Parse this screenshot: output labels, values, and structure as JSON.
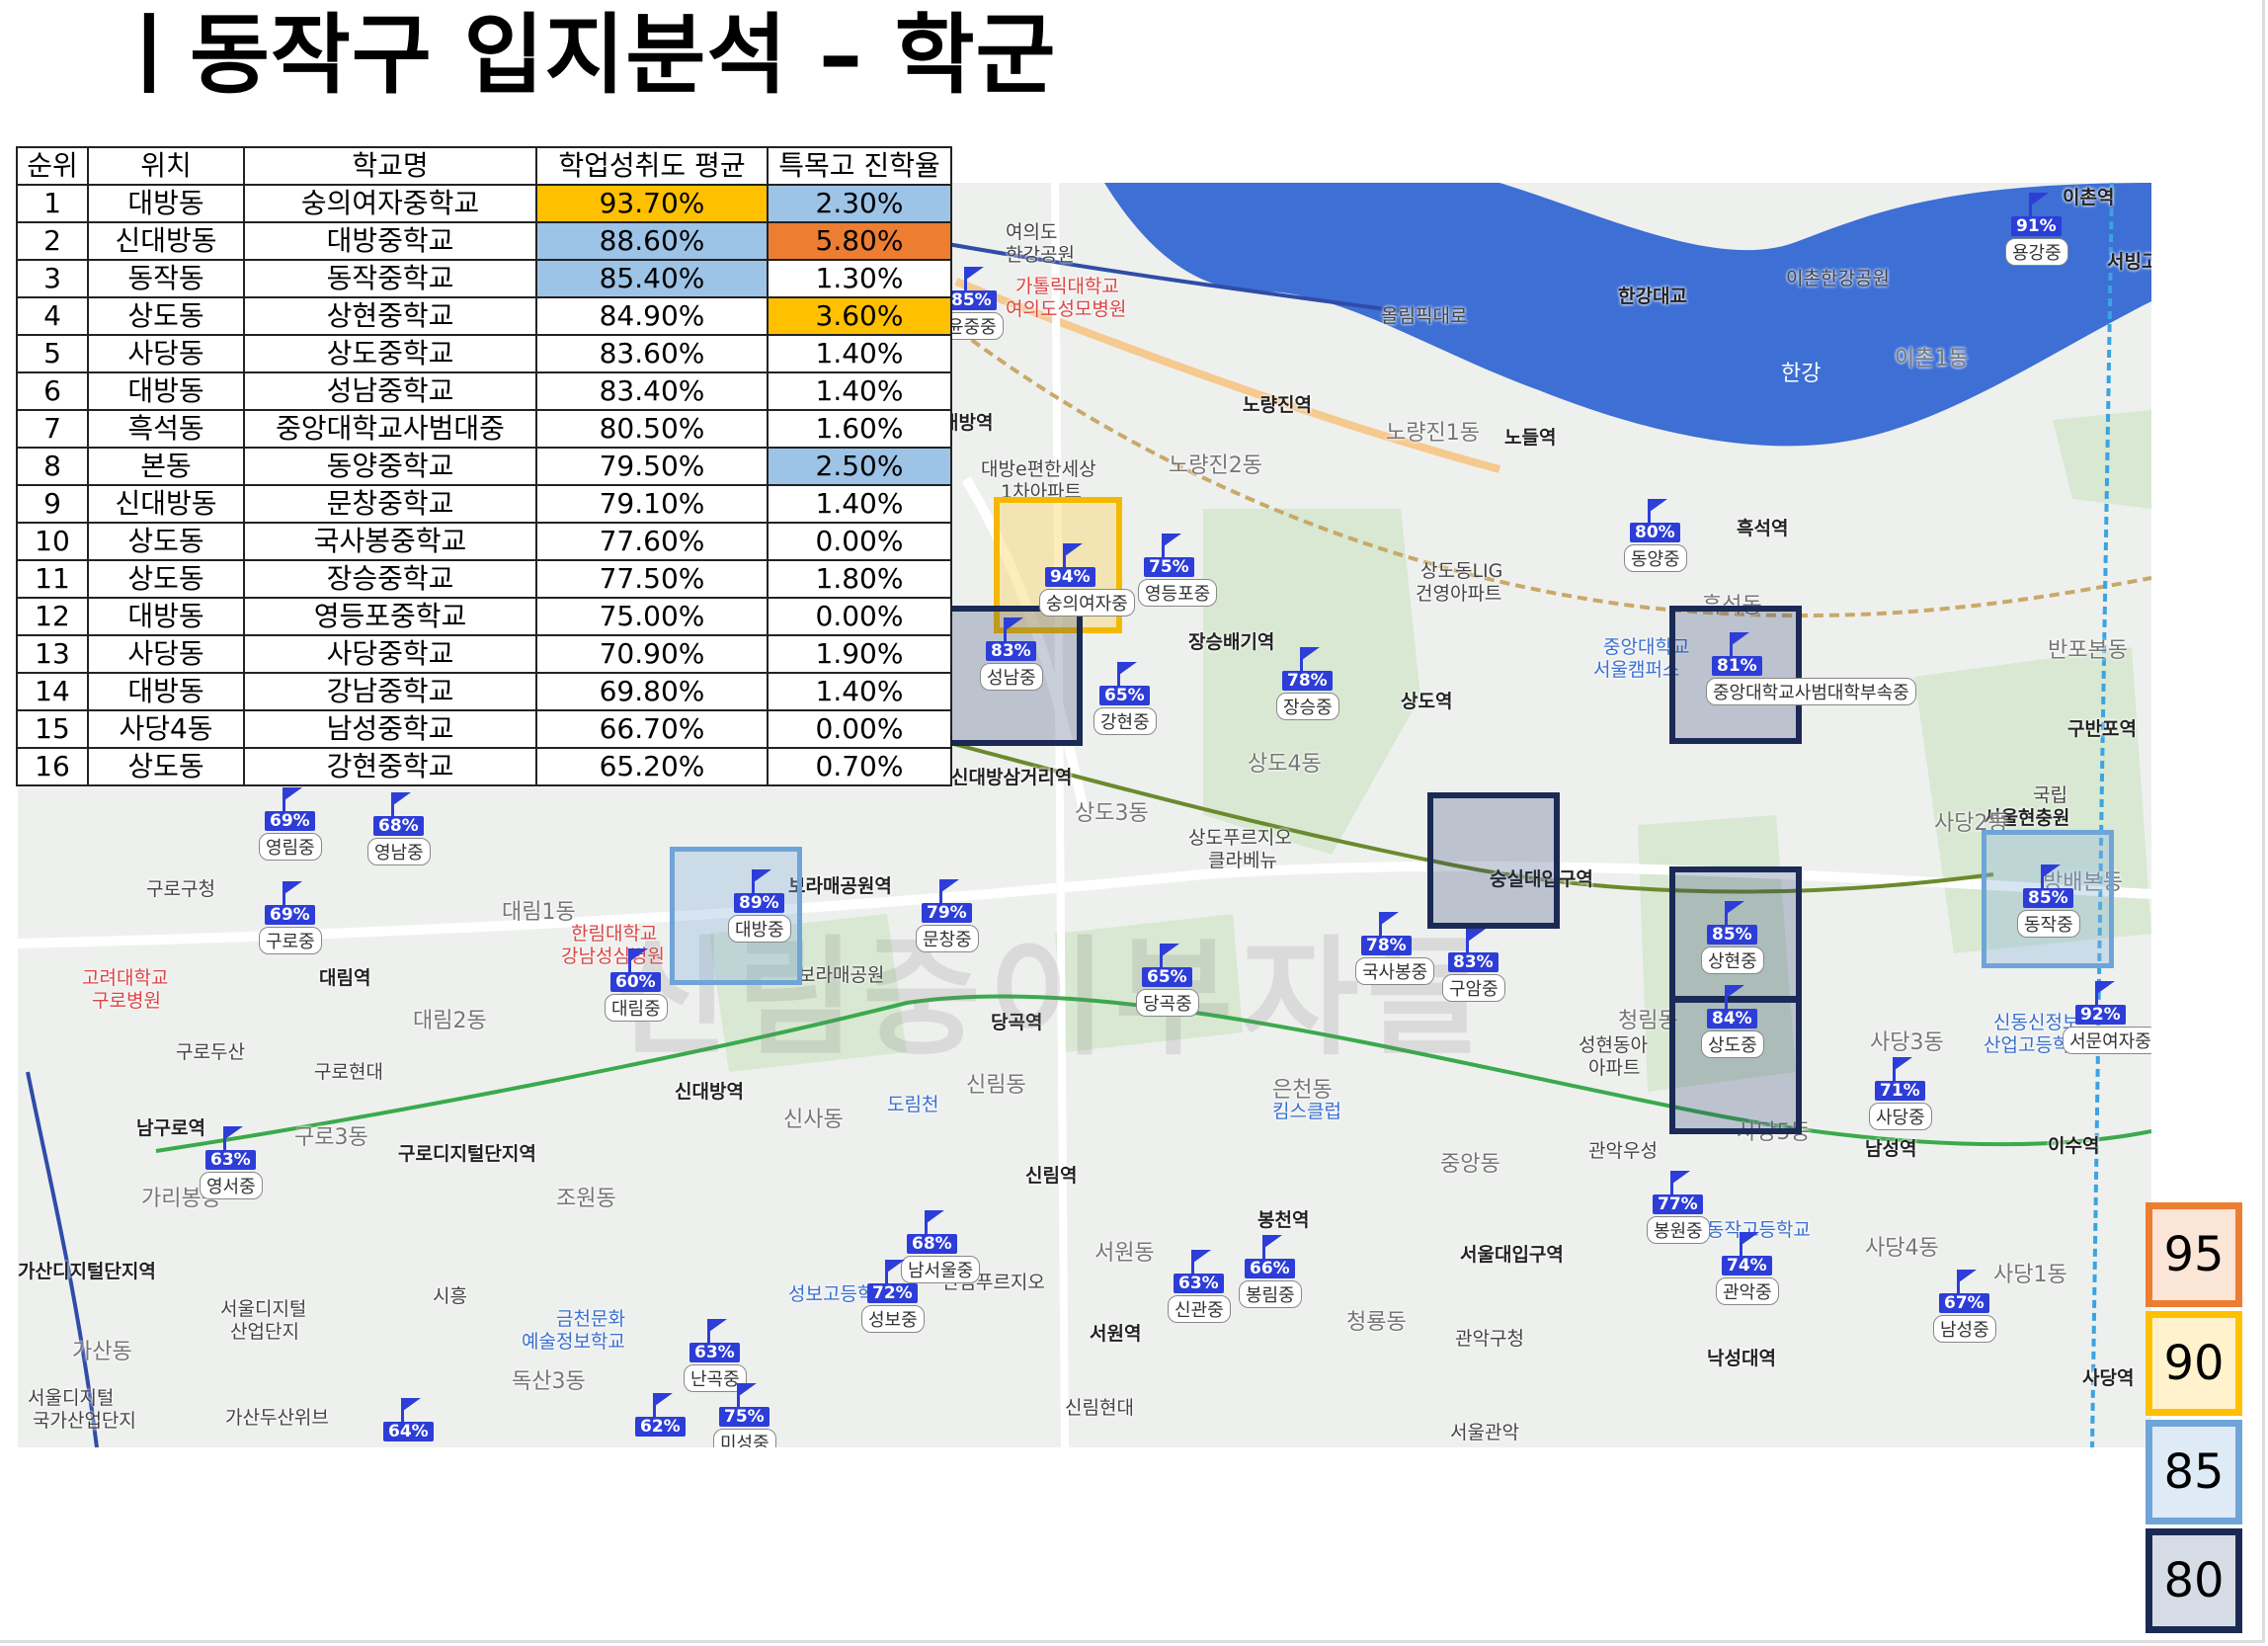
{
  "title": "ㅣ동작구 입지분석 – 학군",
  "table": {
    "headers": [
      "순위",
      "위치",
      "학교명",
      "학업성취도 평균",
      "특목고 진학율"
    ],
    "rows": [
      {
        "rank": "1",
        "location": "대방동",
        "school": "숭의여자중학교",
        "score": "93.70%",
        "rate": "2.30%"
      },
      {
        "rank": "2",
        "location": "신대방동",
        "school": "대방중학교",
        "score": "88.60%",
        "rate": "5.80%"
      },
      {
        "rank": "3",
        "location": "동작동",
        "school": "동작중학교",
        "score": "85.40%",
        "rate": "1.30%"
      },
      {
        "rank": "4",
        "location": "상도동",
        "school": "상현중학교",
        "score": "84.90%",
        "rate": "3.60%"
      },
      {
        "rank": "5",
        "location": "사당동",
        "school": "상도중학교",
        "score": "83.60%",
        "rate": "1.40%"
      },
      {
        "rank": "6",
        "location": "대방동",
        "school": "성남중학교",
        "score": "83.40%",
        "rate": "1.40%"
      },
      {
        "rank": "7",
        "location": "흑석동",
        "school": "중앙대학교사범대중",
        "score": "80.50%",
        "rate": "1.60%"
      },
      {
        "rank": "8",
        "location": "본동",
        "school": "동양중학교",
        "score": "79.50%",
        "rate": "2.50%"
      },
      {
        "rank": "9",
        "location": "신대방동",
        "school": "문창중학교",
        "score": "79.10%",
        "rate": "1.40%"
      },
      {
        "rank": "10",
        "location": "상도동",
        "school": "국사봉중학교",
        "score": "77.60%",
        "rate": "0.00%"
      },
      {
        "rank": "11",
        "location": "상도동",
        "school": "장승중학교",
        "score": "77.50%",
        "rate": "1.80%"
      },
      {
        "rank": "12",
        "location": "대방동",
        "school": "영등포중학교",
        "score": "75.00%",
        "rate": "0.00%"
      },
      {
        "rank": "13",
        "location": "사당동",
        "school": "사당중학교",
        "score": "70.90%",
        "rate": "1.90%"
      },
      {
        "rank": "14",
        "location": "대방동",
        "school": "강남중학교",
        "score": "69.80%",
        "rate": "1.40%"
      },
      {
        "rank": "15",
        "location": "사당4동",
        "school": "남성중학교",
        "score": "66.70%",
        "rate": "0.00%"
      },
      {
        "rank": "16",
        "location": "상도동",
        "school": "강현중학교",
        "score": "65.20%",
        "rate": "0.70%"
      }
    ],
    "highlight_colors": {
      "yellow": "#ffc000",
      "blue": "#9dc3e6",
      "orange": "#ed7d31"
    }
  },
  "map": {
    "watermark": "신림중이부자들",
    "places": {
      "p1": "여의도",
      "p2": "한강공원",
      "p3": "가톨릭대학교",
      "p4": "여의도성모병원",
      "p5": "올림픽대로",
      "p6": "한강대교",
      "p7": "이촌한강공원",
      "p8": "이촌1동",
      "p9": "한강",
      "p10": "노량진역",
      "p11": "노량진1동",
      "p12": "노들역",
      "p13": "노량진2동",
      "p14": "대방역",
      "p15": "대방e편한세상",
      "p16": "1차아파트",
      "p17": "흑석역",
      "p18": "상도동LIG",
      "p19": "건영아파트",
      "p20": "중앙대학교",
      "p21": "서울캠퍼스",
      "p22": "흑석동",
      "p23": "반포본동",
      "p24": "구반포역",
      "p25": "장승배기역",
      "p26": "상도역",
      "p27": "상도4동",
      "p28": "신대방삼거리역",
      "p29": "상도3동",
      "p30": "상도푸르지오",
      "p31": "클라베뉴",
      "p32": "숭실대입구역",
      "p33": "국립",
      "p34": "서울현충원",
      "p35": "사당2동",
      "p36": "방배본동",
      "p37": "구로구청",
      "p38": "보라매공원역",
      "p39": "대림1동",
      "p40": "한림대학교",
      "p41": "강남성심병원",
      "p42": "보라매공원",
      "p43": "고려대학교",
      "p44": "구로병원",
      "p45": "대림역",
      "p46": "대림2동",
      "p47": "당곡역",
      "p48": "신대방역",
      "p49": "신림동",
      "p50": "신사동",
      "p51": "도림천",
      "p52": "은천동",
      "p53": "킴스클럽",
      "p54": "청림동",
      "p55": "성현동아",
      "p56": "아파트",
      "p57": "사당3동",
      "p58": "사당5동",
      "p59": "남성역",
      "p60": "이수역",
      "p61": "신동신정보",
      "p62": "산업고등학교",
      "p63": "구로두산",
      "p64": "구로현대",
      "p65": "남구로역",
      "p66": "구로3동",
      "p67": "구로디지털단지역",
      "p68": "가리봉동",
      "p69": "조원동",
      "p70": "신림역",
      "p71": "봉천역",
      "p72": "중앙동",
      "p73": "관악우성",
      "p74": "동작고등학교",
      "p75": "사당4동",
      "p76": "사당1동",
      "p77": "가산디지털단지역",
      "p78": "서울디지털",
      "p79": "산업단지",
      "p80": "시흥",
      "p81": "금천문화",
      "p82": "예술정보학교",
      "p83": "성보고등학교",
      "p84": "신림푸르지오",
      "p85": "서원동",
      "p86": "서울대입구역",
      "p87": "서원역",
      "p88": "관악구청",
      "p89": "청룡동",
      "p90": "낙성대역",
      "p91": "가산동",
      "p92": "독산3동",
      "p93": "서울디지털",
      "p94": "국가산업단지",
      "p95": "가산두산위브",
      "p96": "신림현대",
      "p97": "서울관악",
      "p98": "사당역",
      "p99": "이촌역",
      "p100": "서빙고",
      "p101": "용강중"
    },
    "pins": [
      {
        "pct": "91%",
        "name": "용강중"
      },
      {
        "pct": "85%",
        "name": "윤중중"
      },
      {
        "pct": "80%",
        "name": "동양중"
      },
      {
        "pct": "75%",
        "name": "영등포중"
      },
      {
        "pct": "94%",
        "name": "숭의여자중"
      },
      {
        "pct": "83%",
        "name": "성남중"
      },
      {
        "pct": "78%",
        "name": "장승중"
      },
      {
        "pct": "65%",
        "name": "강현중"
      },
      {
        "pct": "81%",
        "name": "중앙대학교사범대학부속중"
      },
      {
        "pct": "69%",
        "name": "영림중"
      },
      {
        "pct": "68%",
        "name": "영남중"
      },
      {
        "pct": "69%",
        "name": "구로중"
      },
      {
        "pct": "89%",
        "name": "대방중"
      },
      {
        "pct": "79%",
        "name": "문창중"
      },
      {
        "pct": "60%",
        "name": "대림중"
      },
      {
        "pct": "65%",
        "name": "당곡중"
      },
      {
        "pct": "78%",
        "name": "국사봉중"
      },
      {
        "pct": "83%",
        "name": "구암중"
      },
      {
        "pct": "85%",
        "name": "상현중"
      },
      {
        "pct": "84%",
        "name": "상도중"
      },
      {
        "pct": "85%",
        "name": "동작중"
      },
      {
        "pct": "92%",
        "name": "서문여자중"
      },
      {
        "pct": "71%",
        "name": "사당중"
      },
      {
        "pct": "63%",
        "name": "영서중"
      },
      {
        "pct": "77%",
        "name": "봉원중"
      },
      {
        "pct": "68%",
        "name": "남서울중"
      },
      {
        "pct": "72%",
        "name": "성보중"
      },
      {
        "pct": "63%",
        "name": "신관중"
      },
      {
        "pct": "66%",
        "name": "봉림중"
      },
      {
        "pct": "74%",
        "name": "관악중"
      },
      {
        "pct": "67%",
        "name": "남성중"
      },
      {
        "pct": "63%",
        "name": "난곡중"
      },
      {
        "pct": "62%",
        "name": ""
      },
      {
        "pct": "75%",
        "name": "미성중"
      },
      {
        "pct": "64%",
        "name": ""
      }
    ]
  },
  "legend": [
    "95",
    "90",
    "85",
    "80"
  ],
  "colors": {
    "level95": "#ed7d31",
    "level90": "#ffc000",
    "level85": "#6fa4d8",
    "level80": "#1b2a55",
    "pin": "#2d3dd8",
    "river": "#3d6fd4"
  }
}
